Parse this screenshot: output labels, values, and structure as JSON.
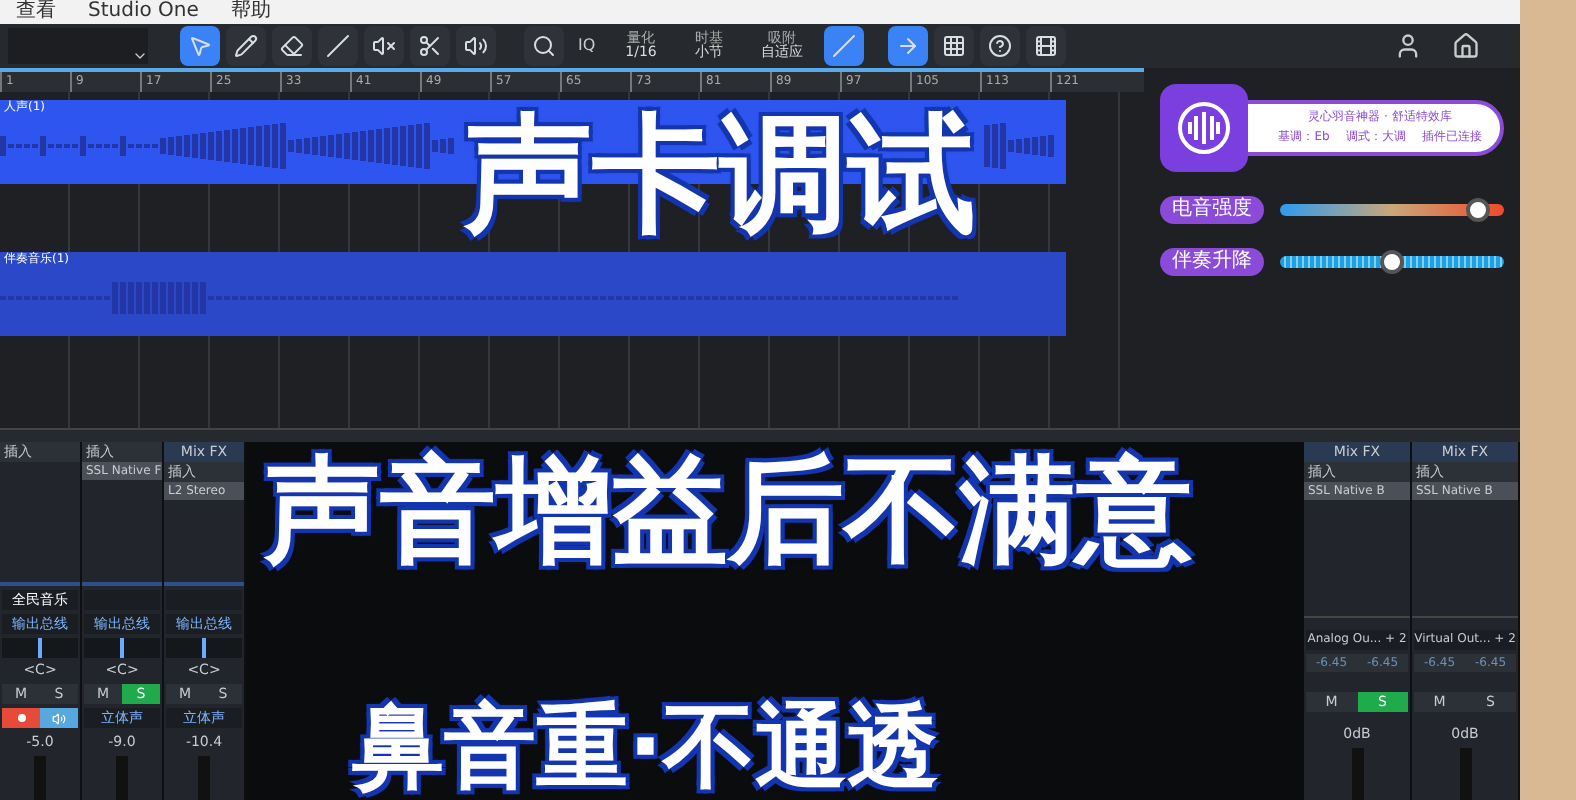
{
  "menu": [
    "查看",
    "Studio One",
    "帮助"
  ],
  "toolbar": {
    "iq": "IQ",
    "settings": [
      {
        "label": "量化",
        "value": "1/16"
      },
      {
        "label": "时基",
        "value": "小节"
      },
      {
        "label": "吸附",
        "value": "自适应"
      }
    ]
  },
  "ruler": [
    "1",
    "9",
    "17",
    "25",
    "33",
    "41",
    "49",
    "57",
    "65",
    "73",
    "81",
    "89",
    "97",
    "105",
    "113",
    "121"
  ],
  "clips": [
    {
      "name": "人声(1)",
      "kind": "vocal"
    },
    {
      "name": "伴奏音乐(1)",
      "kind": "backing"
    }
  ],
  "plugin": {
    "title": "灵心羽音神器 · 舒适特效库",
    "info": [
      "基调：Eb",
      "调式：大调",
      "插件已连接"
    ],
    "sliders": [
      {
        "label": "电音强度",
        "kind": "gradient",
        "level": 0.88
      },
      {
        "label": "伴奏升降",
        "kind": "striped",
        "level": 0.5
      }
    ]
  },
  "channels_left": [
    {
      "header": "插入",
      "name": "全民音乐",
      "output": "输出总线",
      "pan": "<C>",
      "mute": "M",
      "solo_label": "S",
      "solo": false,
      "record": true,
      "monitor": true,
      "volume": "-5.0"
    },
    {
      "header": "插入",
      "plugins": [
        "SSL Native F"
      ],
      "output": "输出总线",
      "pan": "<C>",
      "mute": "M",
      "solo_label": "S",
      "solo": true,
      "mode": "立体声",
      "volume": "-9.0"
    },
    {
      "fx": "Mix FX",
      "header": "插入",
      "plugins": [
        "L2 Stereo"
      ],
      "output": "输出总线",
      "pan": "<C>",
      "mute": "M",
      "solo_label": "S",
      "solo": false,
      "mode": "立体声",
      "volume": "-10.4"
    }
  ],
  "channels_right": [
    {
      "fx": "Mix FX",
      "header": "插入",
      "plugins": [
        "SSL Native B"
      ],
      "output": "Analog Ou... + 2",
      "levels": [
        "-6.45",
        "-6.45"
      ],
      "mute": "M",
      "solo_label": "S",
      "solo": true,
      "volume": "0dB"
    },
    {
      "fx": "Mix FX",
      "header": "插入",
      "plugins": [
        "SSL Native B"
      ],
      "output": "Virtual Out... + 2",
      "levels": [
        "-6.45",
        "-6.45"
      ],
      "mute": "M",
      "solo_label": "S",
      "solo": false,
      "volume": "0dB"
    }
  ],
  "captions": [
    "声卡调试",
    "声音增益后不满意",
    "鼻音重·不通透"
  ]
}
